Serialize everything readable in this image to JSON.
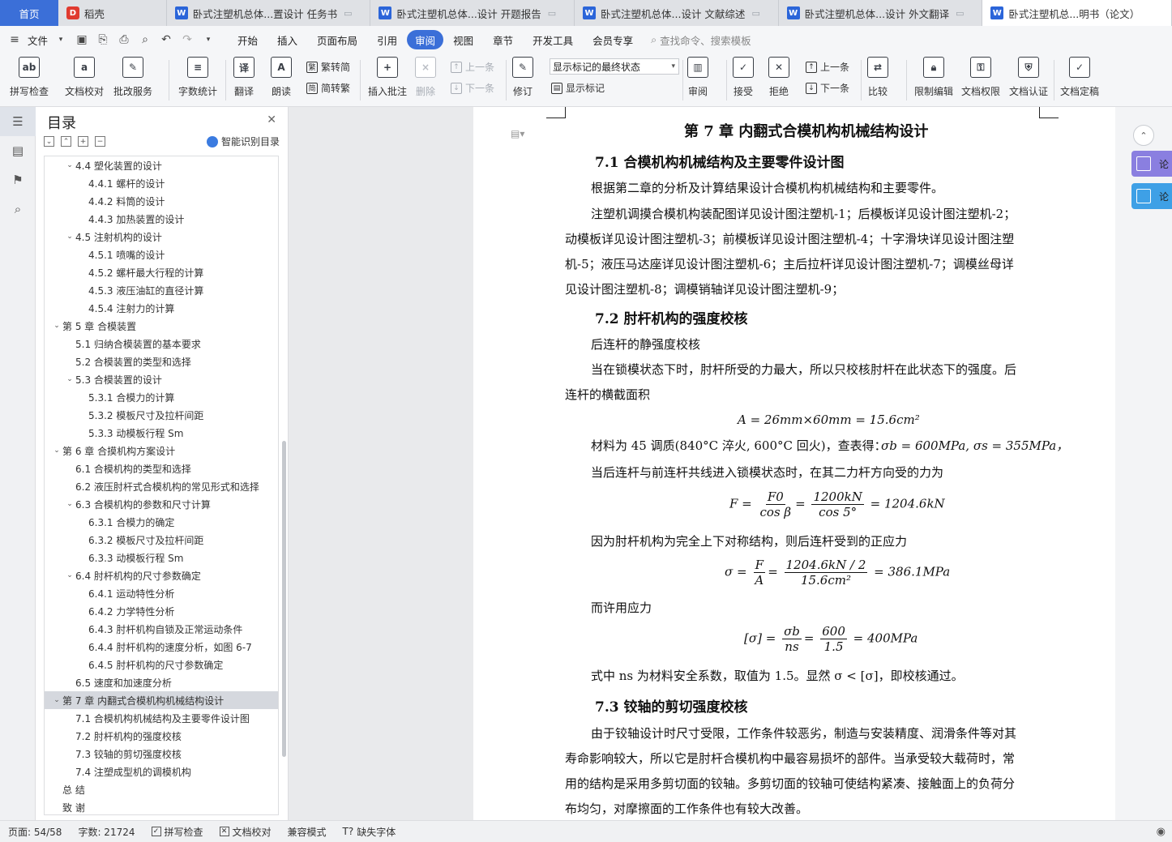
{
  "tabs": {
    "home": "首页",
    "daoke": "稻壳",
    "doc1": "卧式注塑机总体...置设计 任务书",
    "doc2": "卧式注塑机总体...设计 开题报告",
    "doc3": "卧式注塑机总体...设计 文献综述",
    "doc4": "卧式注塑机总体...设计 外文翻译",
    "doc5": "卧式注塑机总...明书（论文）"
  },
  "menu": {
    "file": "文件",
    "items": [
      "开始",
      "插入",
      "页面布局",
      "引用",
      "审阅",
      "视图",
      "章节",
      "开发工具",
      "会员专享"
    ],
    "search": "查找命令、搜索模板"
  },
  "ribbon": {
    "spellcheck": "拼写检查",
    "doccheck": "文档校对",
    "review_service": "批改服务",
    "wordcount": "字数统计",
    "translate": "翻译",
    "read": "朗读",
    "t2s": "繁转简",
    "s2t": "简转繁",
    "insert_comment": "插入批注",
    "delete": "删除",
    "prev": "上一条",
    "next": "下一条",
    "track": "修订",
    "markup_select": "显示标记的最终状态",
    "show_markup": "显示标记",
    "review": "审阅",
    "accept": "接受",
    "reject": "拒绝",
    "prev2": "上一条",
    "next2": "下一条",
    "compare": "比较",
    "restrict": "限制编辑",
    "doc_perm": "文档权限",
    "doc_cert": "文档认证",
    "finalize": "文档定稿"
  },
  "toc": {
    "title": "目录",
    "smart": "智能识别目录",
    "items": [
      {
        "text": "4.4 塑化装置的设计",
        "level": 1,
        "caret": "down"
      },
      {
        "text": "4.4.1 螺杆的设计",
        "level": 2
      },
      {
        "text": "4.4.2 料筒的设计",
        "level": 2
      },
      {
        "text": "4.4.3 加热装置的设计",
        "level": 2
      },
      {
        "text": "4.5 注射机构的设计",
        "level": 1,
        "caret": "down"
      },
      {
        "text": "4.5.1 喷嘴的设计",
        "level": 2
      },
      {
        "text": "4.5.2 螺杆最大行程的计算",
        "level": 2
      },
      {
        "text": "4.5.3 液压油缸的直径计算",
        "level": 2
      },
      {
        "text": "4.5.4 注射力的计算",
        "level": 2
      },
      {
        "text": "第 5 章  合模装置",
        "level": 0,
        "caret": "down"
      },
      {
        "text": "5.1  归纳合模装置的基本要求",
        "level": 1
      },
      {
        "text": "5.2 合模装置的类型和选择",
        "level": 1
      },
      {
        "text": "5.3  合模装置的设计",
        "level": 1,
        "caret": "down"
      },
      {
        "text": "5.3.1 合模力的计算",
        "level": 2
      },
      {
        "text": "5.3.2 模板尺寸及拉杆间距",
        "level": 2
      },
      {
        "text": "5.3.3 动模板行程 Sm",
        "level": 2
      },
      {
        "text": "第 6 章  合摸机构方案设计",
        "level": 0,
        "caret": "down"
      },
      {
        "text": "6.1  合模机构的类型和选择",
        "level": 1
      },
      {
        "text": "6.2  液压肘杆式合模机构的常见形式和选择",
        "level": 1
      },
      {
        "text": "6.3 合模机构的参数和尺寸计算",
        "level": 1,
        "caret": "down"
      },
      {
        "text": "6.3.1 合模力的确定",
        "level": 2
      },
      {
        "text": "6.3.2  模板尺寸及拉杆间距",
        "level": 2
      },
      {
        "text": "6.3.3  动模板行程 Sm",
        "level": 2
      },
      {
        "text": "6.4  肘杆机构的尺寸参数确定",
        "level": 1,
        "caret": "down"
      },
      {
        "text": "6.4.1 运动特性分析",
        "level": 2
      },
      {
        "text": "6.4.2 力学特性分析",
        "level": 2
      },
      {
        "text": "6.4.3 肘杆机构自锁及正常运动条件",
        "level": 2
      },
      {
        "text": "6.4.4 肘杆机构的速度分析，如图 6-7",
        "level": 2
      },
      {
        "text": "6.4.5 肘杆机构的尺寸参数确定",
        "level": 2
      },
      {
        "text": "6.5  速度和加速度分析",
        "level": 1
      },
      {
        "text": "第 7 章  内翻式合模机构机械结构设计",
        "level": 0,
        "caret": "down",
        "selected": true
      },
      {
        "text": "7.1  合模机构机械结构及主要零件设计图",
        "level": 1
      },
      {
        "text": "7.2 肘杆机构的强度校核",
        "level": 1
      },
      {
        "text": "7.3 铰轴的剪切强度校核",
        "level": 1
      },
      {
        "text": "7.4  注塑成型机的调模机构",
        "level": 1
      },
      {
        "text": "总    结",
        "level": 0
      },
      {
        "text": "致    谢",
        "level": 0
      }
    ]
  },
  "doc": {
    "chapter": "第 7 章  内翻式合模机构机械结构设计",
    "s71": "7.1  合模机构机械结构及主要零件设计图",
    "p1": "根据第二章的分析及计算结果设计合模机构机械结构和主要零件。",
    "p2a": "注塑机调摸合模机构装配图详见设计图注塑机-1；后模板详见设计图注塑机-2；",
    "p2b": "动模板详见设计图注塑机-3；前模板详见设计图注塑机-4；十字滑块详见设计图注塑",
    "p2c": "机-5；液压马达座详见设计图注塑机-6；主后拉杆详见设计图注塑机-7；调模丝母详",
    "p2d": "见设计图注塑机-8；调模销轴详见设计图注塑机-9；",
    "s72": "7.2 肘杆机构的强度校核",
    "p3": "后连杆的静强度校核",
    "p4a": "当在锁模状态下时，肘杆所受的力最大，所以只校核肘杆在此状态下的强度。后",
    "p4b": "连杆的横截面积",
    "eq1": "A = 26mm×60mm = 15.6cm²",
    "p5": "材料为 45 调质(840°C 淬火, 600°C 回火)，查表得：",
    "p5eq": "σb = 600MPa, σs = 355MPa，",
    "p6": "当后连杆与前连杆共线进入锁模状态时，在其二力杆方向受的力为",
    "eq2_lhs": "F =",
    "eq2_n1": "F0",
    "eq2_d1": "cos β",
    "eq2_n2": "1200kN",
    "eq2_d2": "cos 5°",
    "eq2_rhs": "= 1204.6kN",
    "p7": "因为肘杆机构为完全上下对称结构，则后连杆受到的正应力",
    "eq3_lhs": "σ =",
    "eq3_n1": "F",
    "eq3_d1": "A",
    "eq3_n2": "1204.6kN / 2",
    "eq3_d2": "15.6cm²",
    "eq3_rhs": "= 386.1MPa",
    "p8": "而许用应力",
    "eq4_lhs": "[σ] =",
    "eq4_n1": "σb",
    "eq4_d1": "ns",
    "eq4_n2": "600",
    "eq4_d2": "1.5",
    "eq4_rhs": "= 400MPa",
    "p9": "式中 ns 为材料安全系数，取值为 1.5。显然 σ < [σ]，即校核通过。",
    "s73": "7.3 铰轴的剪切强度校核",
    "p10a": "由于铰轴设计时尺寸受限，工作条件较恶劣，制造与安装精度、润滑条件等对其",
    "p10b": "寿命影响较大，所以它是肘杆合模机构中最容易损坏的部件。当承受较大载荷时，常",
    "p10c": "用的结构是采用多剪切面的铰轴。多剪切面的铰轴可使结构紧凑、接触面上的负荷分",
    "p10d": "布均匀，对摩擦面的工作条件也有较大改善。"
  },
  "rightpanel": {
    "btn1": "论",
    "btn2": "论"
  },
  "status": {
    "page": "页面: 54/58",
    "words": "字数: 21724",
    "spell": "拼写检查",
    "proof": "文档校对",
    "compat": "兼容模式",
    "missing_font": "缺失字体"
  },
  "colors": {
    "accent": "#3b6fd8",
    "rp_btn1": "#8a7fe0",
    "rp_btn2": "#3ea0e6"
  }
}
